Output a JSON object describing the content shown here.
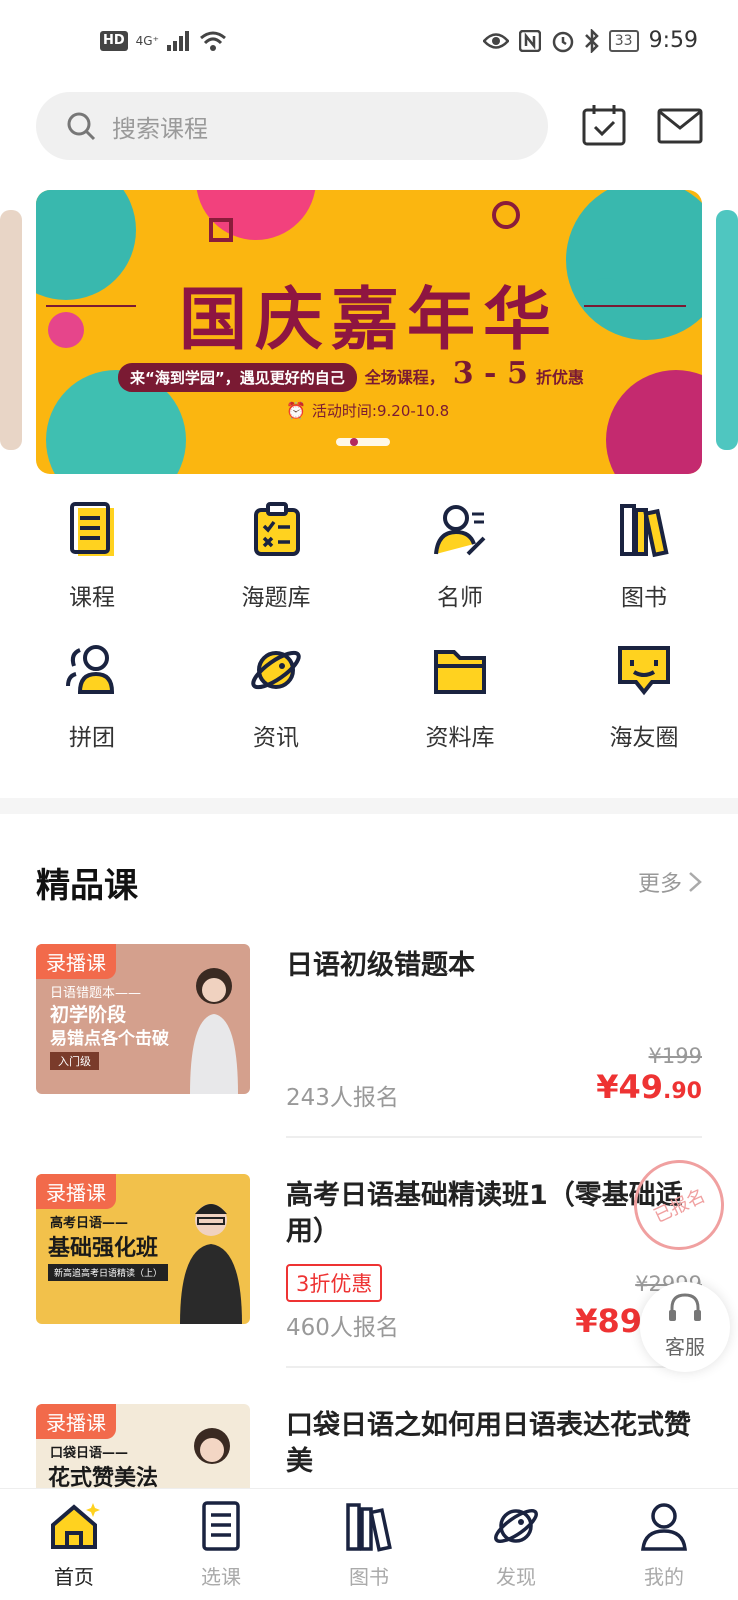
{
  "status_bar": {
    "hd": "HD",
    "network": "4G⁺",
    "battery": "33",
    "time": "9:59"
  },
  "search": {
    "placeholder": "搜索课程"
  },
  "banner": {
    "title": "国庆嘉年华",
    "slogan": "来“海到学园”，遇见更好的自己",
    "offer_prefix": "全场课程，",
    "offer_big": "3 - 5",
    "offer_suffix": "折优惠",
    "period": "活动时间:9.20-10.8"
  },
  "grid": [
    {
      "label": "课程",
      "icon": "book-icon"
    },
    {
      "label": "海题库",
      "icon": "clipboard-icon"
    },
    {
      "label": "名师",
      "icon": "teacher-icon"
    },
    {
      "label": "图书",
      "icon": "books-icon"
    },
    {
      "label": "拼团",
      "icon": "group-icon"
    },
    {
      "label": "资讯",
      "icon": "planet-icon"
    },
    {
      "label": "资料库",
      "icon": "folder-icon"
    },
    {
      "label": "海友圈",
      "icon": "chat-icon"
    }
  ],
  "section": {
    "title": "精品课",
    "more": "更多"
  },
  "courses": [
    {
      "tag": "录播课",
      "thumb_line1": "日语错题本——",
      "thumb_line2": "初学阶段",
      "thumb_line3": "易错点各个击破",
      "thumb_badge": "入门级",
      "title": "日语初级错题本",
      "enrolled": "243人报名",
      "original_price": "¥199",
      "price_main": "¥49",
      "price_decimal": ".90"
    },
    {
      "tag": "录播课",
      "thumb_line1": "高考日语——",
      "thumb_line2": "基础强化班",
      "thumb_line3": "新高追高考日语精读（上）",
      "title": "高考日语基础精读班1（零基础适用）",
      "promo": "3折优惠",
      "enrolled": "460人报名",
      "original_price": "¥2999",
      "price_main": "¥89",
      "stamp": "已报名"
    },
    {
      "tag": "录播课",
      "thumb_line1": "口袋日语——",
      "thumb_line2": "花式赞美法",
      "title": "口袋日语之如何用日语表达花式赞美"
    }
  ],
  "service": {
    "label": "客服"
  },
  "tabs": [
    {
      "label": "首页",
      "icon": "home-icon"
    },
    {
      "label": "选课",
      "icon": "book-list-icon"
    },
    {
      "label": "图书",
      "icon": "books-icon"
    },
    {
      "label": "发现",
      "icon": "planet-icon"
    },
    {
      "label": "我的",
      "icon": "user-icon"
    }
  ],
  "colors": {
    "accent": "#ffd21f",
    "price": "#e33333",
    "banner": "#fbb610",
    "tag": "#f26a4b"
  }
}
